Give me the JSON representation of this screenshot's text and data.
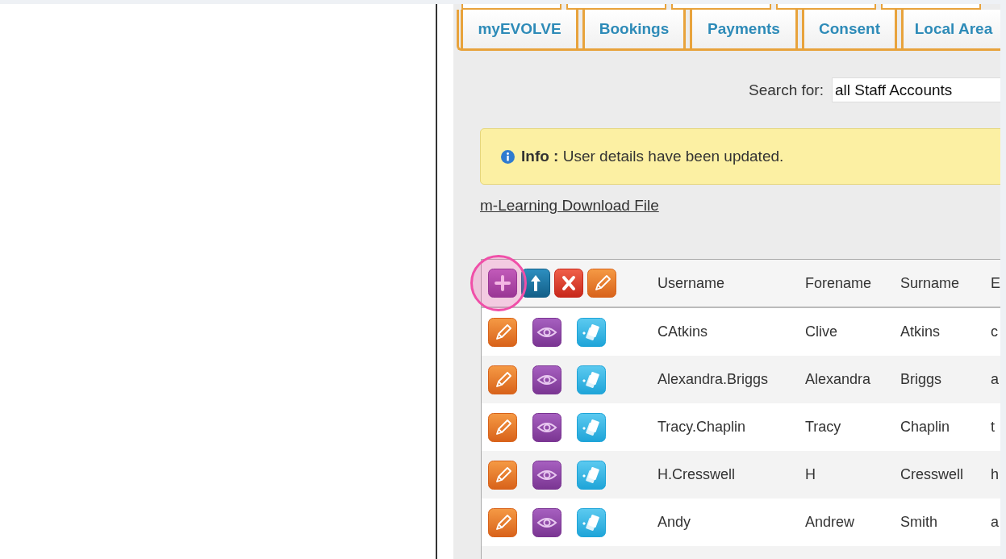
{
  "tabs": [
    {
      "label": "myEVOLVE",
      "selected": false
    },
    {
      "label": "Bookings",
      "selected": false
    },
    {
      "label": "Payments",
      "selected": false
    },
    {
      "label": "Consent",
      "selected": false
    },
    {
      "label": "Local Area",
      "selected": false
    }
  ],
  "search": {
    "label": "Search for:",
    "value": "all Staff Accounts"
  },
  "info": {
    "text": "**Info :** User details have been updated."
  },
  "download_link": "m-Learning Download File",
  "table": {
    "columns": [
      "Username",
      "Forename",
      "Surname",
      "E"
    ],
    "rows": [
      {
        "username": "CAtkins",
        "forename": "Clive",
        "surname": "Atkins",
        "column_4": "c"
      },
      {
        "username": "Alexandra.Briggs",
        "forename": "Alexandra",
        "surname": "Briggs",
        "column_4": "a"
      },
      {
        "username": "Tracy.Chaplin",
        "forename": "Tracy",
        "surname": "Chaplin",
        "column_4": "t"
      },
      {
        "username": "H.Cresswell",
        "forename": "H",
        "surname": "Cresswell",
        "column_4": "h"
      },
      {
        "username": "Andy",
        "forename": "Andrew",
        "surname": "Smith",
        "column_4": "a"
      }
    ]
  }
}
